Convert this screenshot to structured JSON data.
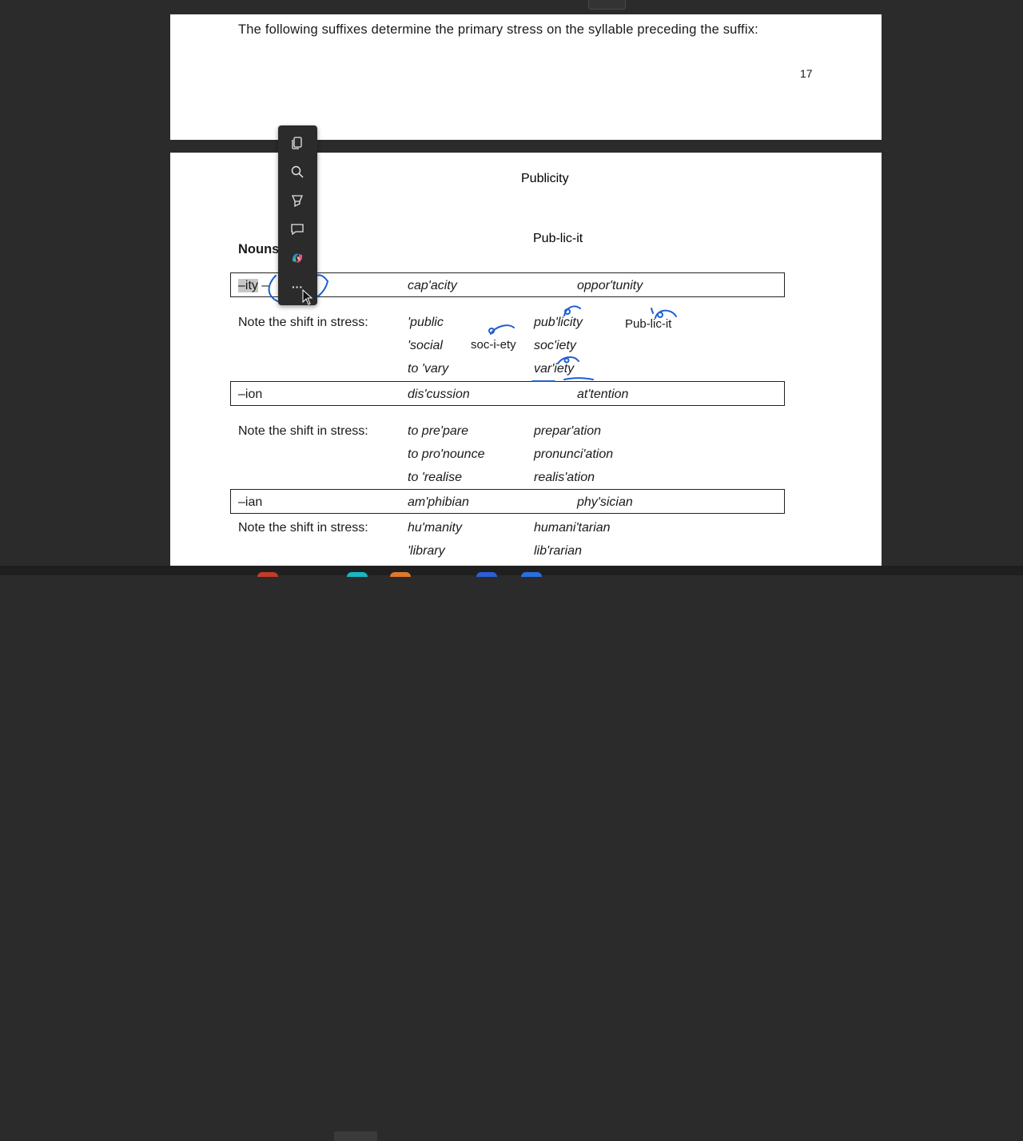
{
  "page1": {
    "paragraph": "The following suffixes determine the primary stress on the syllable preceding the suffix:",
    "page_number": "17"
  },
  "page2": {
    "handwritten_title": "Publicity",
    "handwritten_syllables": "Pub-lic-it",
    "nouns_label": "Nouns",
    "rows": [
      {
        "suffix": "–ity",
        "suffix_tail": " –",
        "ex1": "cap'acity",
        "ex2": "oppor'tunity"
      },
      {
        "suffix": "–ion",
        "ex1": "dis'cussion",
        "ex2": "at'tention"
      },
      {
        "suffix": "–ian",
        "ex1": "am'phibian",
        "ex2": "phy'sician"
      }
    ],
    "shifts": [
      {
        "label": "Note the shift in stress:",
        "left": [
          "'public",
          "'social",
          "to 'vary"
        ],
        "right": [
          "pub'licity",
          "soc'iety",
          "var'iety"
        ],
        "annotation_society": "soc-i-ety",
        "annotation_publicity": "Pub-lic-it"
      },
      {
        "label": "Note the shift in stress:",
        "left": [
          "to pre'pare",
          "to pro'nounce",
          "to 'realise"
        ],
        "right": [
          "prepar'ation",
          "pronunci'ation",
          "realis'ation"
        ]
      },
      {
        "label": "Note the shift in stress:",
        "left": [
          "hu'manity",
          "'library"
        ],
        "right": [
          "humani'tarian",
          "lib'rarian"
        ]
      }
    ]
  },
  "popup_toolbar": {
    "items": [
      "copy-icon",
      "search-icon",
      "highlight-icon",
      "comment-icon",
      "copilot-icon",
      "more-icon"
    ],
    "more_label": "···"
  },
  "colors": {
    "ink_blue": "#1f5fd0",
    "toolbar_bg": "#2b2b2b",
    "background": "#2b2b2b"
  }
}
